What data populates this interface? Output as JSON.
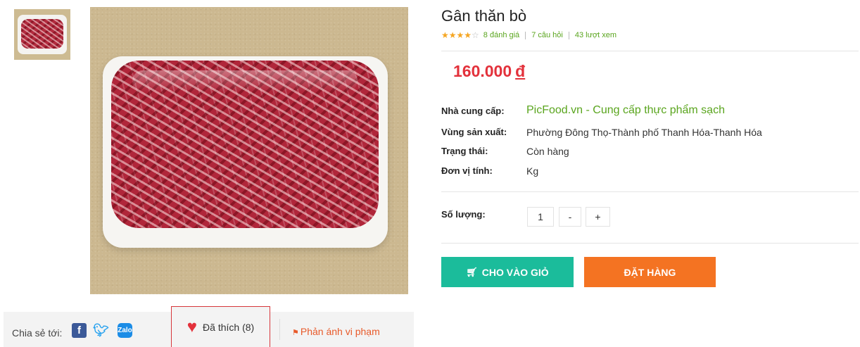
{
  "product": {
    "title": "Gân thăn bò",
    "rating_stars": 4,
    "reviews": "8 đánh giá",
    "questions": "7 câu hỏi",
    "views": "43 lượt xem",
    "price": "160.000",
    "currency": "đ"
  },
  "details": [
    {
      "key": "Nhà cung cấp:",
      "value": "PicFood.vn - Cung cấp thực phẩm sạch"
    },
    {
      "key": "Vùng sản xuất:",
      "value": "Phường Đông Thọ-Thành phố Thanh Hóa-Thanh Hóa"
    },
    {
      "key": "Trạng thái:",
      "value": "Còn hàng"
    },
    {
      "key": "Đơn vị tính:",
      "value": "Kg"
    }
  ],
  "quantity": {
    "label": "Số lượng:",
    "value": "1",
    "minus": "-",
    "plus": "+"
  },
  "buttons": {
    "add_to_cart": "CHO VÀO GIỎ",
    "order": "ĐẶT HÀNG"
  },
  "share": {
    "label": "Chia sẻ tới:",
    "liked": "Đã thích (8)",
    "report": "Phản ánh vi phạm"
  },
  "colors": {
    "price": "#e3313b",
    "cart_button": "#1bbc9b",
    "order_button": "#f47322",
    "link_green": "#5aa51e"
  },
  "icons": {
    "cart": "cart-icon",
    "heart": "heart-icon",
    "flag": "flag-icon",
    "facebook": "facebook-icon",
    "twitter": "twitter-icon",
    "zalo": "zalo-icon"
  }
}
